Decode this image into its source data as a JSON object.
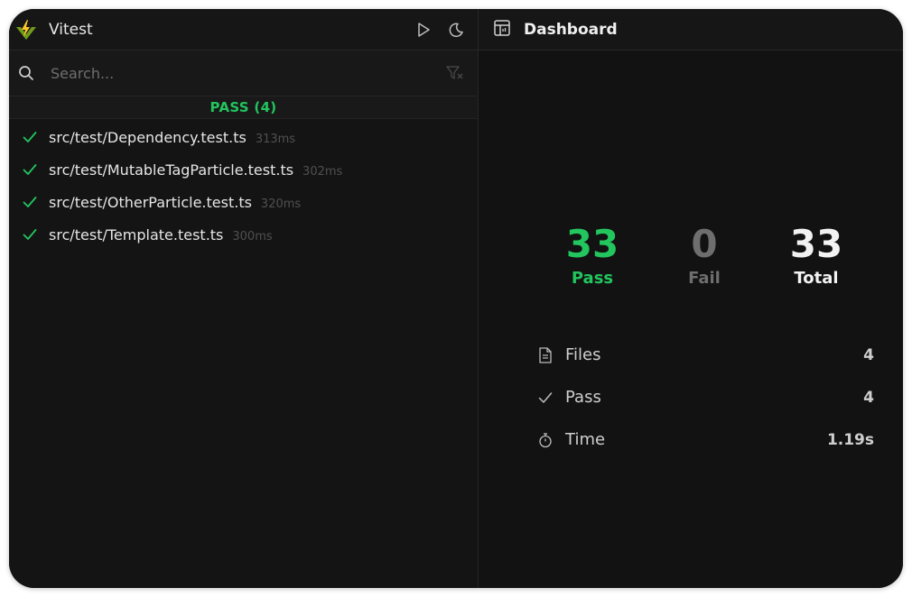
{
  "app": {
    "title": "Vitest"
  },
  "search": {
    "placeholder": "Search..."
  },
  "group": {
    "label": "PASS (4)"
  },
  "files": [
    {
      "name": "src/test/Dependency.test.ts",
      "duration": "313ms"
    },
    {
      "name": "src/test/MutableTagParticle.test.ts",
      "duration": "302ms"
    },
    {
      "name": "src/test/OtherParticle.test.ts",
      "duration": "320ms"
    },
    {
      "name": "src/test/Template.test.ts",
      "duration": "300ms"
    }
  ],
  "dashboard": {
    "title": "Dashboard",
    "stats": {
      "pass": {
        "value": "33",
        "label": "Pass"
      },
      "fail": {
        "value": "0",
        "label": "Fail"
      },
      "total": {
        "value": "33",
        "label": "Total"
      }
    },
    "details": {
      "files": {
        "label": "Files",
        "value": "4"
      },
      "pass": {
        "label": "Pass",
        "value": "4"
      },
      "time": {
        "label": "Time",
        "value": "1.19s"
      }
    }
  },
  "colors": {
    "pass": "#22c55e",
    "fail": "#6e6e6e",
    "background": "#121212",
    "logo_bolt": "#fcc72b",
    "logo_mark": "#729b1b"
  },
  "icons": {
    "logo": "vitest-logo-icon",
    "run": "play-icon",
    "theme": "moon-icon",
    "search": "search-icon",
    "filter": "filter-clear-icon",
    "check": "check-icon",
    "dashboard": "dashboard-icon",
    "files": "file-icon",
    "pass": "check-icon",
    "time": "stopwatch-icon"
  }
}
